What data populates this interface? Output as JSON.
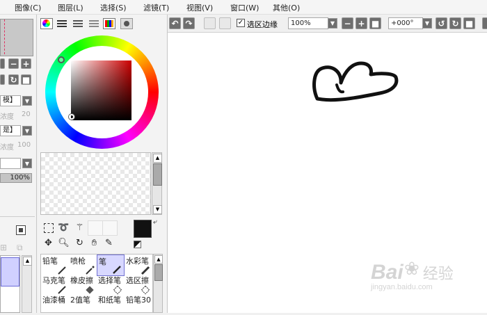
{
  "menu": {
    "items": [
      "图像(C)",
      "图层(L)",
      "选择(S)",
      "滤镜(T)",
      "视图(V)",
      "窗口(W)",
      "其他(O)"
    ]
  },
  "toolbar": {
    "selection_edge_label": "选区边缘",
    "selection_edge_checked": true,
    "zoom_value": "100%",
    "rotation_value": "+000°"
  },
  "left_panel": {
    "label_density_1": "浓度",
    "value_density_1": "20",
    "label_density_2": "浓度",
    "value_density_2": "100",
    "opacity_value": "100%",
    "combo_1_tail": "模】",
    "combo_2_tail": "是】"
  },
  "color_panel": {
    "hue_color": "#cc0000",
    "foreground_color": "#111111",
    "background_color": "#ffffff"
  },
  "brushes": {
    "rows": [
      [
        "铅笔",
        "喷枪",
        "笔",
        "水彩笔"
      ],
      [
        "马克笔",
        "橡皮擦",
        "选择笔",
        "选区擦"
      ],
      [
        "油漆桶",
        "2值笔",
        "和纸笔",
        "铅笔30"
      ]
    ],
    "selected": "笔"
  },
  "watermark": {
    "brand": "Bai",
    "brand_cn": "经验",
    "url": "jingyan.baidu.com"
  },
  "colors": {
    "accent_selected": "#d8d8ff",
    "button_dark": "#6e6e6e",
    "canvas_bg": "#ffffff",
    "stroke": "#111111"
  }
}
